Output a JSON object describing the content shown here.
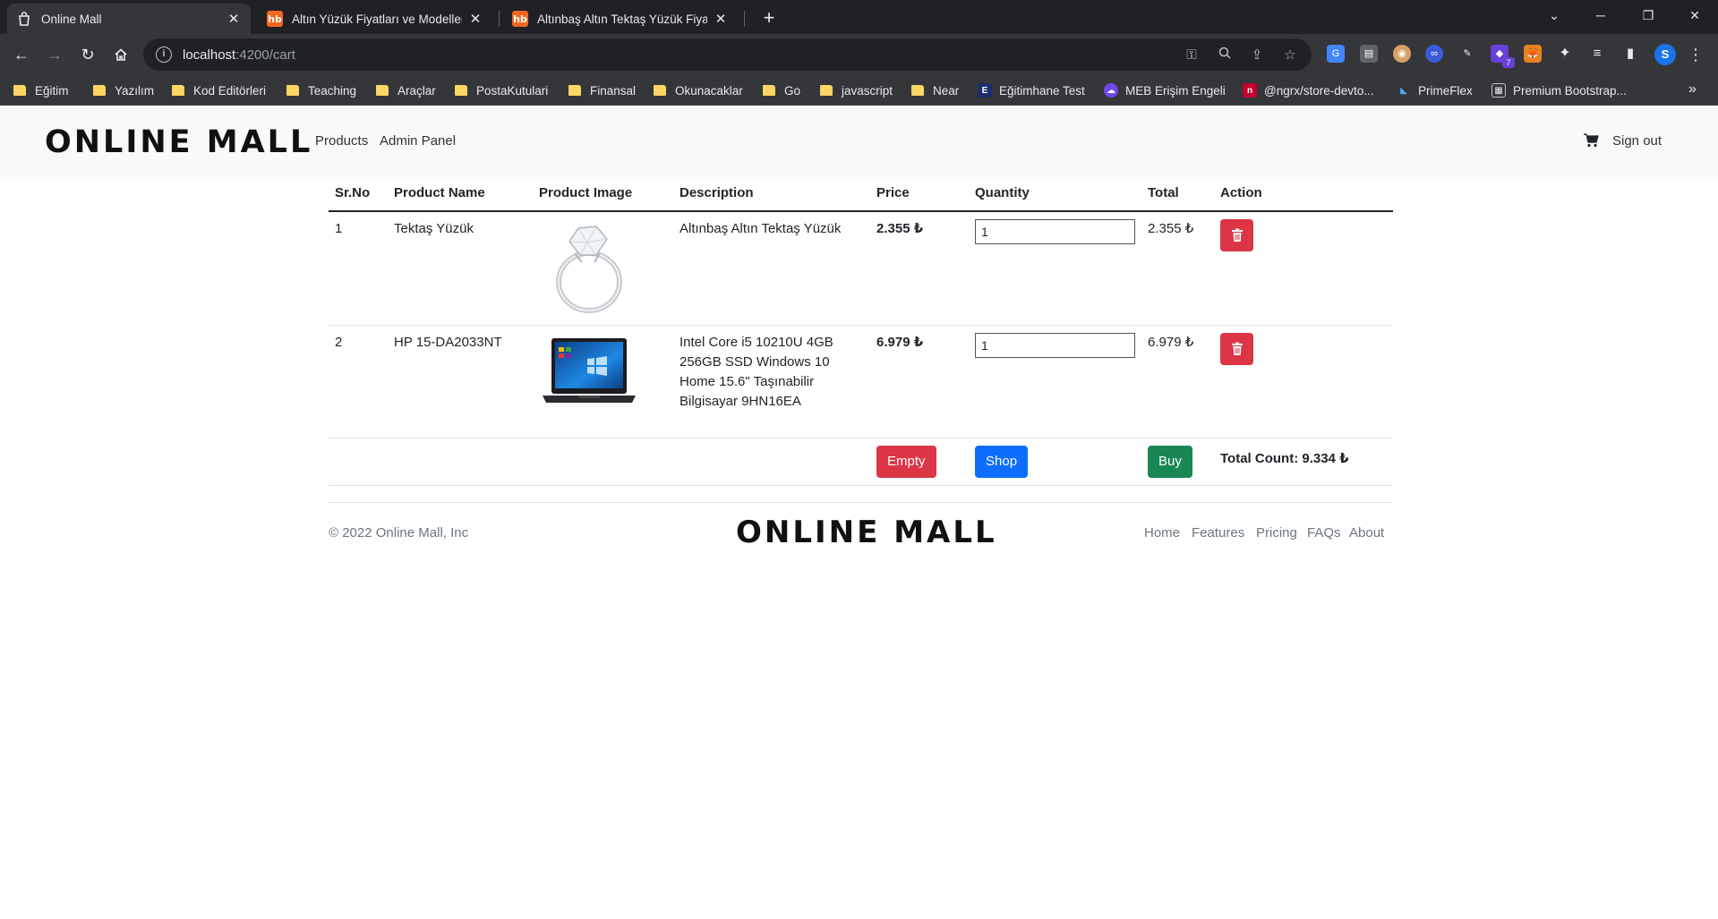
{
  "browser": {
    "tabs": [
      {
        "title": "Online Mall",
        "active": true
      },
      {
        "title": "Altın Yüzük Fiyatları ve Modelleri",
        "active": false
      },
      {
        "title": "Altınbaş Altın Tektaş Yüzük Fiyatı",
        "active": false
      }
    ],
    "new_tab": "+",
    "url_host": "localhost",
    "url_path": ":4200/cart",
    "profile_initial": "S",
    "bookmarks": [
      "Eğitim",
      "Yazılım",
      "Kod Editörleri",
      "Teaching",
      "Araçlar",
      "PostaKutulari",
      "Finansal",
      "Okunacaklar",
      "Go",
      "javascript",
      "Near",
      "Eğitimhane Test",
      "MEB Erişim Engeli",
      "@ngrx/store-devto...",
      "PrimeFlex",
      "Premium Bootstrap..."
    ],
    "extension_badge": "7"
  },
  "nav": {
    "brand": "ONLINE MALL",
    "links": [
      "Products",
      "Admin Panel"
    ],
    "signout": "Sign out"
  },
  "cart": {
    "headers": [
      "Sr.No",
      "Product Name",
      "Product Image",
      "Description",
      "Price",
      "Quantity",
      "Total",
      "Action"
    ],
    "rows": [
      {
        "srno": "1",
        "name": "Tektaş Yüzük",
        "image": "ring-image",
        "description": "Altınbaş Altın Tektaş Yüzük",
        "price": "2.355 ₺",
        "quantity": "1",
        "total": "2.355 ₺"
      },
      {
        "srno": "2",
        "name": "HP 15-DA2033NT",
        "image": "laptop-image",
        "description": "Intel Core i5 10210U 4GB 256GB SSD Windows 10 Home 15.6\" Taşınabilir Bilgisayar 9HN16EA",
        "price": "6.979 ₺",
        "quantity": "1",
        "total": "6.979 ₺"
      }
    ],
    "buttons": {
      "empty": "Empty",
      "shop": "Shop",
      "buy": "Buy"
    },
    "total_count": "Total Count: 9.334 ₺"
  },
  "footer": {
    "copyright": "© 2022 Online Mall, Inc",
    "brand": "ONLINE MALL",
    "links": [
      "Home",
      "Features",
      "Pricing",
      "FAQs",
      "About"
    ]
  },
  "colors": {
    "danger": "#dc3545",
    "primary": "#0d6efd",
    "success": "#198754",
    "chrome_dark": "#202124",
    "chrome_toolbar": "#35363a"
  }
}
